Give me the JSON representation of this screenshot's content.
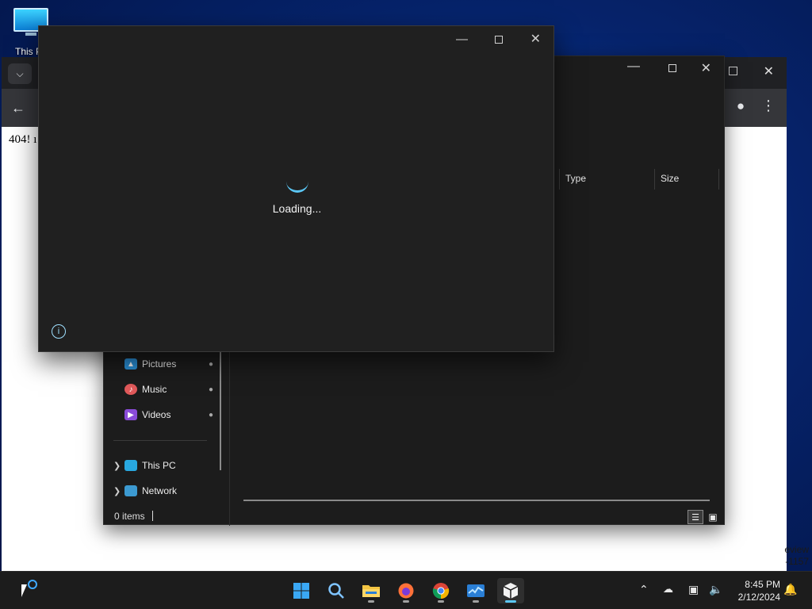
{
  "desktop": {
    "this_pc_label": "This P"
  },
  "browser": {
    "tab_dropdown_icon": "chevron-down-icon",
    "back_icon": "arrow-left-icon",
    "page_text": "404! ı",
    "watermark_line1": "eview",
    "watermark_line2": "-1157"
  },
  "explorer": {
    "columns": {
      "type": "Type",
      "size": "Size"
    },
    "nav": {
      "pictures": "Pictures",
      "music": "Music",
      "videos": "Videos",
      "this_pc": "This PC",
      "network": "Network"
    },
    "status": "0 items"
  },
  "loader": {
    "loading_text": "Loading...",
    "info_icon": "i"
  },
  "taskbar": {
    "apps": [
      "Start",
      "Search",
      "File Explorer",
      "Firefox",
      "Chrome",
      "Task Manager",
      "Package Installer"
    ],
    "time": "8:45 PM",
    "date": "2/12/2024"
  },
  "colors": {
    "accent": "#5bc7f5",
    "taskbar_bg": "#1c1c1c",
    "window_bg": "#202020"
  }
}
